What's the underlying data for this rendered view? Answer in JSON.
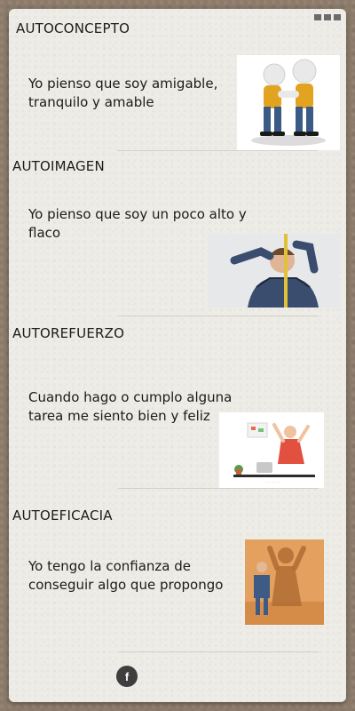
{
  "sections": [
    {
      "title": "AUTOCONCEPTO",
      "text": "Yo pienso que soy amigable, tranquilo y amable",
      "image": "two-figures-handshake-illustration"
    },
    {
      "title": "AUTOIMAGEN",
      "text": "Yo pienso que soy un poco alto y flaco",
      "image": "man-measuring-height-photo"
    },
    {
      "title": "AUTOREFUERZO",
      "text": "Cuando hago o cumplo alguna tarea me siento bien y feliz",
      "image": "happy-worker-celebrating-illustration"
    },
    {
      "title": "AUTOEFICACIA",
      "text": "Yo tengo la confianza de conseguir algo que propongo",
      "image": "businessman-hero-shadow-illustration"
    }
  ],
  "footer": {
    "share_icon": "facebook-icon",
    "share_glyph": "f"
  }
}
